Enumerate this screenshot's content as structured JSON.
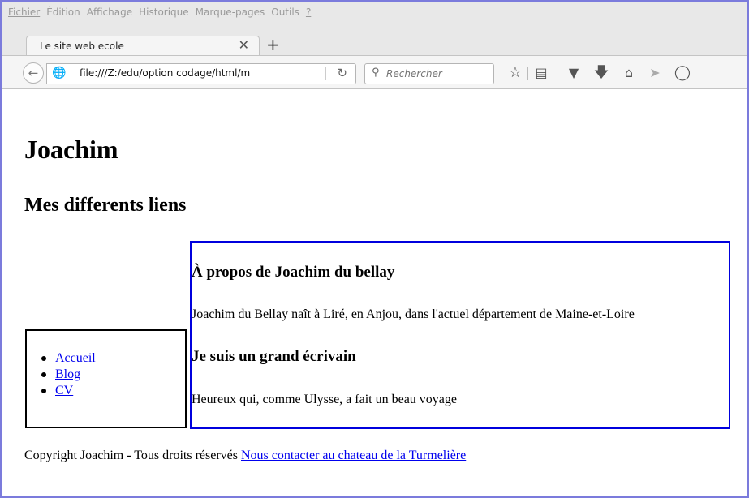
{
  "menu": [
    "Fichier",
    "Édition",
    "Affichage",
    "Historique",
    "Marque-pages",
    "Outils",
    "?"
  ],
  "tab": {
    "title": "Le site web ecole",
    "close": "✕",
    "new": "+"
  },
  "nav": {
    "url": "file:///Z:/edu/option codage/html/m",
    "search_placeholder": "Rechercher"
  },
  "icons": [
    "back-icon",
    "globe-icon",
    "reload-icon",
    "search-icon",
    "star-icon",
    "reading-list-icon",
    "pocket-icon",
    "download-icon",
    "home-icon",
    "send-icon",
    "chat-icon"
  ],
  "page": {
    "h1": "Joachim",
    "h2": "Mes differents liens",
    "links": [
      "Accueil",
      "Blog",
      "CV"
    ],
    "section1_title": "À propos de Joachim du bellay",
    "section1_text": "Joachim du Bellay naît à Liré, en Anjou, dans l'actuel département de Maine-et-Loire",
    "section2_title": "Je suis un grand écrivain",
    "section2_text": "Heureux qui, comme Ulysse, a fait un beau voyage",
    "footer_text": "Copyright Joachim - Tous droits réservés ",
    "footer_link": "Nous contacter au chateau de la Turmelière"
  },
  "colors": {
    "window_border": "#7b7bdc",
    "link": "#0000ee",
    "main_border": "#0000dd"
  }
}
